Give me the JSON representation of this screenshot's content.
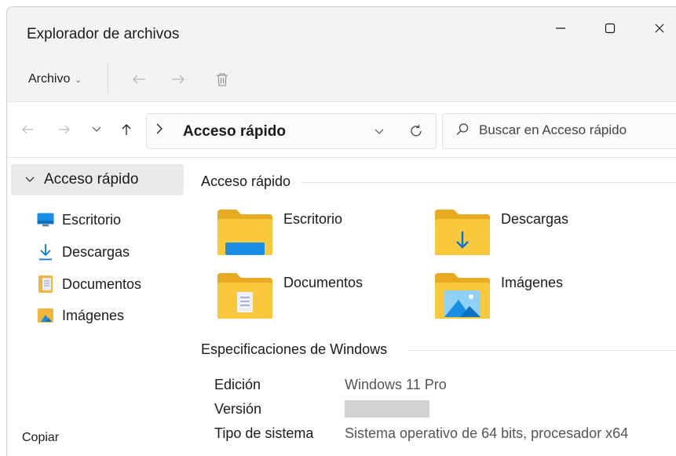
{
  "window": {
    "title": "Explorador de archivos"
  },
  "titlebar": {
    "minimize_icon": "minimize-icon",
    "maximize_icon": "maximize-icon",
    "close_icon": "close-icon"
  },
  "cmdbar": {
    "archivo_label": "Archivo",
    "icons": [
      "back-arrow-icon",
      "forward-arrow-icon",
      "trash-icon"
    ]
  },
  "address": {
    "location": "Acceso rápido",
    "search_placeholder": "Buscar en Acceso rápido"
  },
  "sidebar": {
    "header": "Acceso rápido",
    "items": [
      {
        "label": "Escritorio",
        "icon": "desktop-icon"
      },
      {
        "label": "Descargas",
        "icon": "download-icon"
      },
      {
        "label": "Documentos",
        "icon": "documents-icon"
      },
      {
        "label": "Imágenes",
        "icon": "pictures-icon"
      }
    ],
    "footer_action": "Copiar"
  },
  "quick_access": {
    "title": "Acceso rápido",
    "folders": [
      {
        "label": "Escritorio",
        "icon": "desktop-folder-icon"
      },
      {
        "label": "Descargas",
        "icon": "downloads-folder-icon"
      },
      {
        "label": "Documentos",
        "icon": "documents-folder-icon"
      },
      {
        "label": "Imágenes",
        "icon": "pictures-folder-icon"
      }
    ]
  },
  "specs": {
    "title": "Especificaciones de Windows",
    "rows": [
      {
        "key": "Edición",
        "value": "Windows 11 Pro"
      },
      {
        "key": "Versión",
        "value": ""
      },
      {
        "key": "Tipo de sistema",
        "value": "Sistema operativo de 64 bits, procesador x64"
      }
    ]
  },
  "colors": {
    "folder_yellow": "#f8c93c",
    "folder_back": "#e8a923",
    "accent_blue": "#0a78d4"
  }
}
